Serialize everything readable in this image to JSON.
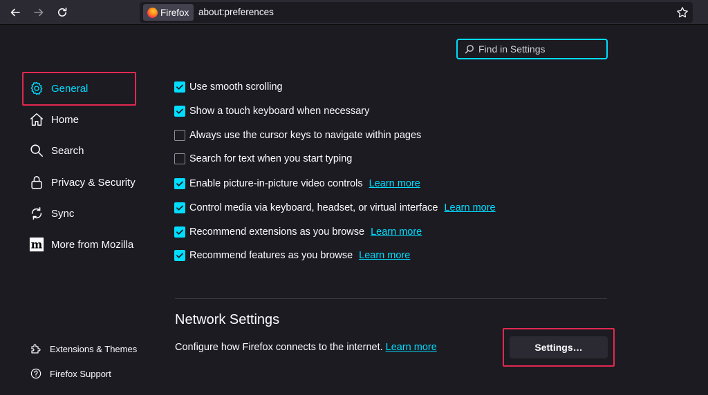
{
  "toolbar": {
    "identity_label": "Firefox",
    "url": "about:preferences"
  },
  "search": {
    "placeholder": "Find in Settings"
  },
  "sidebar": {
    "items": [
      {
        "label": "General",
        "icon": "gear-icon",
        "selected": true
      },
      {
        "label": "Home",
        "icon": "home-icon"
      },
      {
        "label": "Search",
        "icon": "search-icon"
      },
      {
        "label": "Privacy & Security",
        "icon": "lock-icon"
      },
      {
        "label": "Sync",
        "icon": "sync-icon"
      },
      {
        "label": "More from Mozilla",
        "icon": "mozilla-icon"
      }
    ],
    "footer": [
      {
        "label": "Extensions & Themes",
        "icon": "puzzle-icon"
      },
      {
        "label": "Firefox Support",
        "icon": "help-icon"
      }
    ]
  },
  "options": [
    {
      "label": "Use smooth scrolling",
      "checked": true
    },
    {
      "label": "Show a touch keyboard when necessary",
      "checked": true
    },
    {
      "label": "Always use the cursor keys to navigate within pages",
      "checked": false
    },
    {
      "label": "Search for text when you start typing",
      "checked": false
    },
    {
      "label": "Enable picture-in-picture video controls",
      "checked": true,
      "link": "Learn more"
    },
    {
      "label": "Control media via keyboard, headset, or virtual interface",
      "checked": true,
      "link": "Learn more"
    },
    {
      "label": "Recommend extensions as you browse",
      "checked": true,
      "link": "Learn more"
    },
    {
      "label": "Recommend features as you browse",
      "checked": true,
      "link": "Learn more"
    }
  ],
  "network": {
    "title": "Network Settings",
    "description": "Configure how Firefox connects to the internet.",
    "link": "Learn more",
    "button": "Settings…"
  },
  "colors": {
    "background": "#1c1b22",
    "accent": "#00ddff",
    "annotation": "#e22850"
  }
}
